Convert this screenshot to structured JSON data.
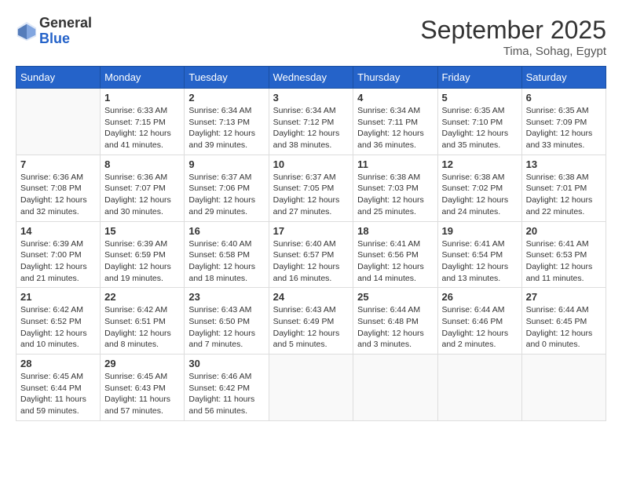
{
  "logo": {
    "general": "General",
    "blue": "Blue"
  },
  "header": {
    "month": "September 2025",
    "location": "Tima, Sohag, Egypt"
  },
  "days_of_week": [
    "Sunday",
    "Monday",
    "Tuesday",
    "Wednesday",
    "Thursday",
    "Friday",
    "Saturday"
  ],
  "weeks": [
    [
      {
        "day": "",
        "info": ""
      },
      {
        "day": "1",
        "info": "Sunrise: 6:33 AM\nSunset: 7:15 PM\nDaylight: 12 hours\nand 41 minutes."
      },
      {
        "day": "2",
        "info": "Sunrise: 6:34 AM\nSunset: 7:13 PM\nDaylight: 12 hours\nand 39 minutes."
      },
      {
        "day": "3",
        "info": "Sunrise: 6:34 AM\nSunset: 7:12 PM\nDaylight: 12 hours\nand 38 minutes."
      },
      {
        "day": "4",
        "info": "Sunrise: 6:34 AM\nSunset: 7:11 PM\nDaylight: 12 hours\nand 36 minutes."
      },
      {
        "day": "5",
        "info": "Sunrise: 6:35 AM\nSunset: 7:10 PM\nDaylight: 12 hours\nand 35 minutes."
      },
      {
        "day": "6",
        "info": "Sunrise: 6:35 AM\nSunset: 7:09 PM\nDaylight: 12 hours\nand 33 minutes."
      }
    ],
    [
      {
        "day": "7",
        "info": "Sunrise: 6:36 AM\nSunset: 7:08 PM\nDaylight: 12 hours\nand 32 minutes."
      },
      {
        "day": "8",
        "info": "Sunrise: 6:36 AM\nSunset: 7:07 PM\nDaylight: 12 hours\nand 30 minutes."
      },
      {
        "day": "9",
        "info": "Sunrise: 6:37 AM\nSunset: 7:06 PM\nDaylight: 12 hours\nand 29 minutes."
      },
      {
        "day": "10",
        "info": "Sunrise: 6:37 AM\nSunset: 7:05 PM\nDaylight: 12 hours\nand 27 minutes."
      },
      {
        "day": "11",
        "info": "Sunrise: 6:38 AM\nSunset: 7:03 PM\nDaylight: 12 hours\nand 25 minutes."
      },
      {
        "day": "12",
        "info": "Sunrise: 6:38 AM\nSunset: 7:02 PM\nDaylight: 12 hours\nand 24 minutes."
      },
      {
        "day": "13",
        "info": "Sunrise: 6:38 AM\nSunset: 7:01 PM\nDaylight: 12 hours\nand 22 minutes."
      }
    ],
    [
      {
        "day": "14",
        "info": "Sunrise: 6:39 AM\nSunset: 7:00 PM\nDaylight: 12 hours\nand 21 minutes."
      },
      {
        "day": "15",
        "info": "Sunrise: 6:39 AM\nSunset: 6:59 PM\nDaylight: 12 hours\nand 19 minutes."
      },
      {
        "day": "16",
        "info": "Sunrise: 6:40 AM\nSunset: 6:58 PM\nDaylight: 12 hours\nand 18 minutes."
      },
      {
        "day": "17",
        "info": "Sunrise: 6:40 AM\nSunset: 6:57 PM\nDaylight: 12 hours\nand 16 minutes."
      },
      {
        "day": "18",
        "info": "Sunrise: 6:41 AM\nSunset: 6:56 PM\nDaylight: 12 hours\nand 14 minutes."
      },
      {
        "day": "19",
        "info": "Sunrise: 6:41 AM\nSunset: 6:54 PM\nDaylight: 12 hours\nand 13 minutes."
      },
      {
        "day": "20",
        "info": "Sunrise: 6:41 AM\nSunset: 6:53 PM\nDaylight: 12 hours\nand 11 minutes."
      }
    ],
    [
      {
        "day": "21",
        "info": "Sunrise: 6:42 AM\nSunset: 6:52 PM\nDaylight: 12 hours\nand 10 minutes."
      },
      {
        "day": "22",
        "info": "Sunrise: 6:42 AM\nSunset: 6:51 PM\nDaylight: 12 hours\nand 8 minutes."
      },
      {
        "day": "23",
        "info": "Sunrise: 6:43 AM\nSunset: 6:50 PM\nDaylight: 12 hours\nand 7 minutes."
      },
      {
        "day": "24",
        "info": "Sunrise: 6:43 AM\nSunset: 6:49 PM\nDaylight: 12 hours\nand 5 minutes."
      },
      {
        "day": "25",
        "info": "Sunrise: 6:44 AM\nSunset: 6:48 PM\nDaylight: 12 hours\nand 3 minutes."
      },
      {
        "day": "26",
        "info": "Sunrise: 6:44 AM\nSunset: 6:46 PM\nDaylight: 12 hours\nand 2 minutes."
      },
      {
        "day": "27",
        "info": "Sunrise: 6:44 AM\nSunset: 6:45 PM\nDaylight: 12 hours\nand 0 minutes."
      }
    ],
    [
      {
        "day": "28",
        "info": "Sunrise: 6:45 AM\nSunset: 6:44 PM\nDaylight: 11 hours\nand 59 minutes."
      },
      {
        "day": "29",
        "info": "Sunrise: 6:45 AM\nSunset: 6:43 PM\nDaylight: 11 hours\nand 57 minutes."
      },
      {
        "day": "30",
        "info": "Sunrise: 6:46 AM\nSunset: 6:42 PM\nDaylight: 11 hours\nand 56 minutes."
      },
      {
        "day": "",
        "info": ""
      },
      {
        "day": "",
        "info": ""
      },
      {
        "day": "",
        "info": ""
      },
      {
        "day": "",
        "info": ""
      }
    ]
  ]
}
